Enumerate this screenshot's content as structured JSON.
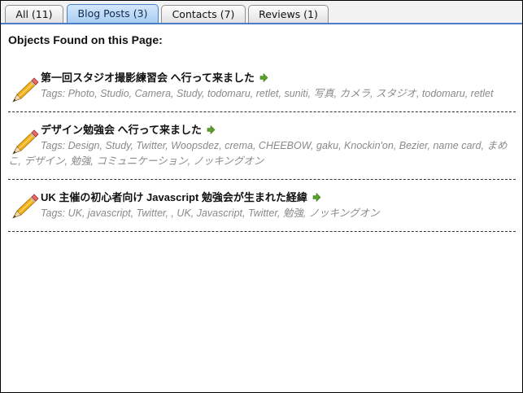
{
  "tabs": [
    {
      "label": "All (11)",
      "active": false
    },
    {
      "label": "Blog Posts (3)",
      "active": true
    },
    {
      "label": "Contacts (7)",
      "active": false
    },
    {
      "label": "Reviews (1)",
      "active": false
    }
  ],
  "heading": "Objects Found on this Page:",
  "items": [
    {
      "title": "第一回スタジオ撮影練習会 へ行って来ました",
      "tags": "Tags: Photo, Studio, Camera, Study, todomaru, retlet, suniti, 写真, カメラ, スタジオ, todomaru, retlet"
    },
    {
      "title": "デザイン勉強会 へ行って来ました",
      "tags": "Tags: Design, Study, Twitter, Woopsdez, crema, CHEEBOW, gaku, Knockin'on, Bezier, name card, まめこ, デザイン, 勉強, コミュニケーション, ノッキングオン"
    },
    {
      "title": "UK 主催の初心者向け Javascript 勉強会が生まれた経緯",
      "tags": "Tags: UK, javascript, Twitter, , UK, Javascript, Twitter, 勉強, ノッキングオン"
    }
  ],
  "icons": {
    "item_icon": "pencil-icon",
    "link_icon": "arrow-right-icon"
  },
  "colors": {
    "tab_active": "#a9cdf3",
    "tab_border_active": "#4a7fc8",
    "tags_text": "#8a8a8a",
    "arrow_green": "#5aa02c"
  }
}
